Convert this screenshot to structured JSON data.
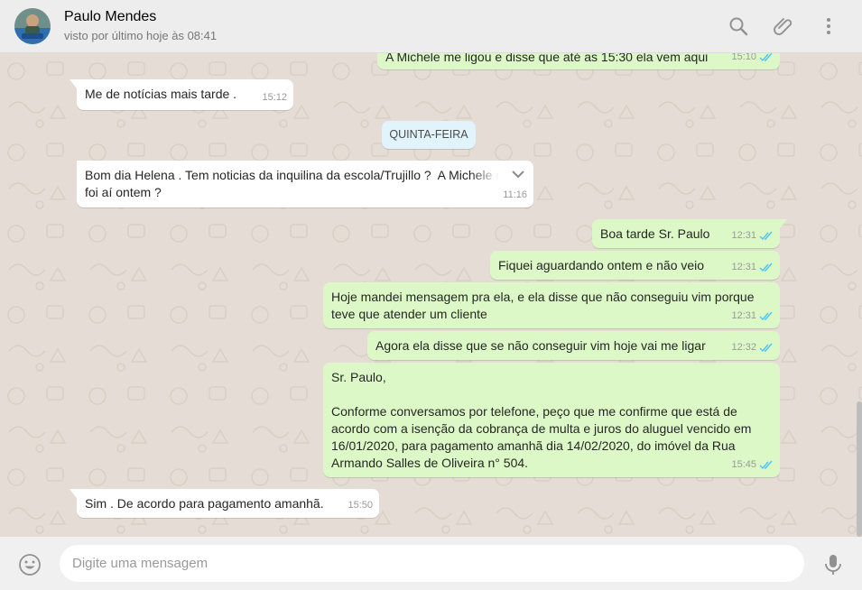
{
  "header": {
    "contact_name": "Paulo Mendes",
    "last_seen": "visto por último hoje às 08:41",
    "icons": [
      "search-icon",
      "attach-icon",
      "menu-icon"
    ]
  },
  "chat": {
    "day_label": "QUINTA-FEIRA",
    "messages": [
      {
        "direction": "out",
        "text": "A Michele me ligou e disse que até as 15:30 ela vem aqui",
        "time": "15:10",
        "status": "read"
      },
      {
        "direction": "in",
        "text": "Me de notícias mais tarde .",
        "time": "15:12"
      },
      {
        "direction": "in",
        "text": "Bom dia Helena . Tem noticias da inquilina da escola/Trujillo ?  A Michele n\nfoi aí ontem ?",
        "time": "11:16"
      },
      {
        "direction": "out",
        "text": "Boa tarde Sr. Paulo",
        "time": "12:31",
        "status": "read"
      },
      {
        "direction": "out",
        "text": "Fiquei aguardando ontem e não veio",
        "time": "12:31",
        "status": "read"
      },
      {
        "direction": "out",
        "text": "Hoje mandei mensagem pra ela, e ela disse que não conseguiu vim porque\nteve que atender um cliente",
        "time": "12:31",
        "status": "read"
      },
      {
        "direction": "out",
        "text": "Agora ela disse que se não conseguir vim hoje vai me ligar",
        "time": "12:32",
        "status": "read"
      },
      {
        "direction": "out",
        "text": "Sr. Paulo,\n\nConforme conversamos por telefone, peço que me confirme que está de\nacordo com a isenção da cobrança de multa e juros do aluguel vencido em\n16/01/2020, para pagamento amanhã dia 14/02/2020, do imóvel da Rua\nArmando Salles de Oliveira n° 504.",
        "time": "15:45",
        "status": "read"
      },
      {
        "direction": "in",
        "text": "Sim . De acordo para pagamento amanhã.",
        "time": "15:50"
      }
    ]
  },
  "composer": {
    "placeholder": "Digite uma mensagem",
    "icons": [
      "emoji-icon",
      "microphone-icon"
    ]
  },
  "colors": {
    "header_bg": "#ededed",
    "chat_bg": "#e5ddd5",
    "outgoing_bubble": "#dcf8c6",
    "incoming_bubble": "#ffffff",
    "read_ticks": "#4fc3f7",
    "day_chip": "#e1f3fb"
  }
}
